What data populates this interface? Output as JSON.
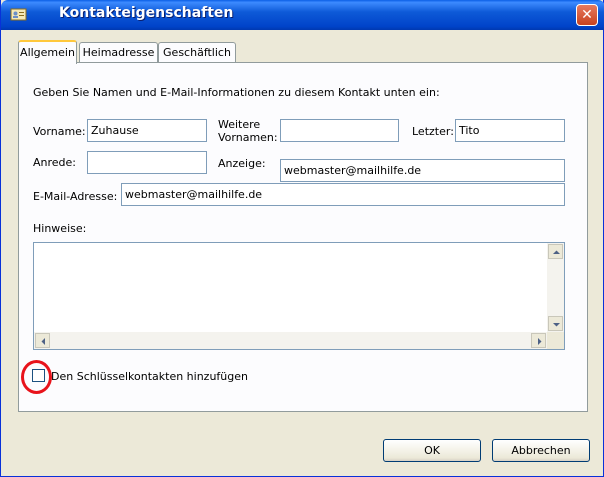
{
  "window": {
    "title": "Kontakteigenschaften",
    "close_glyph": "✕"
  },
  "tabs": [
    {
      "label": "Allgemein",
      "active": true
    },
    {
      "label": "Heimadresse",
      "active": false
    },
    {
      "label": "Geschäftlich",
      "active": false
    }
  ],
  "general": {
    "instruction": "Geben Sie Namen und E-Mail-Informationen zu diesem Kontakt unten ein:",
    "first_name_label": "Vorname:",
    "first_name_value": "Zuhause",
    "middle_name_label_line1": "Weitere",
    "middle_name_label_line2": "Vornamen:",
    "middle_name_value": "",
    "last_name_label": "Letzter:",
    "last_name_value": "Tito",
    "salutation_label": "Anrede:",
    "salutation_value": "",
    "display_label": "Anzeige:",
    "display_value": "webmaster@mailhilfe.de",
    "email_label": "E-Mail-Adresse:",
    "email_value": "webmaster@mailhilfe.de",
    "notes_label": "Hinweise:",
    "notes_value": "",
    "key_contacts_label": "Den Schlüsselkontakten hinzufügen",
    "key_contacts_checked": false
  },
  "buttons": {
    "ok": "OK",
    "cancel": "Abbrechen"
  },
  "colors": {
    "titlebar": "#0054e3",
    "annotation_circle": "#e8131b",
    "dialog_bg": "#ece9d8"
  }
}
